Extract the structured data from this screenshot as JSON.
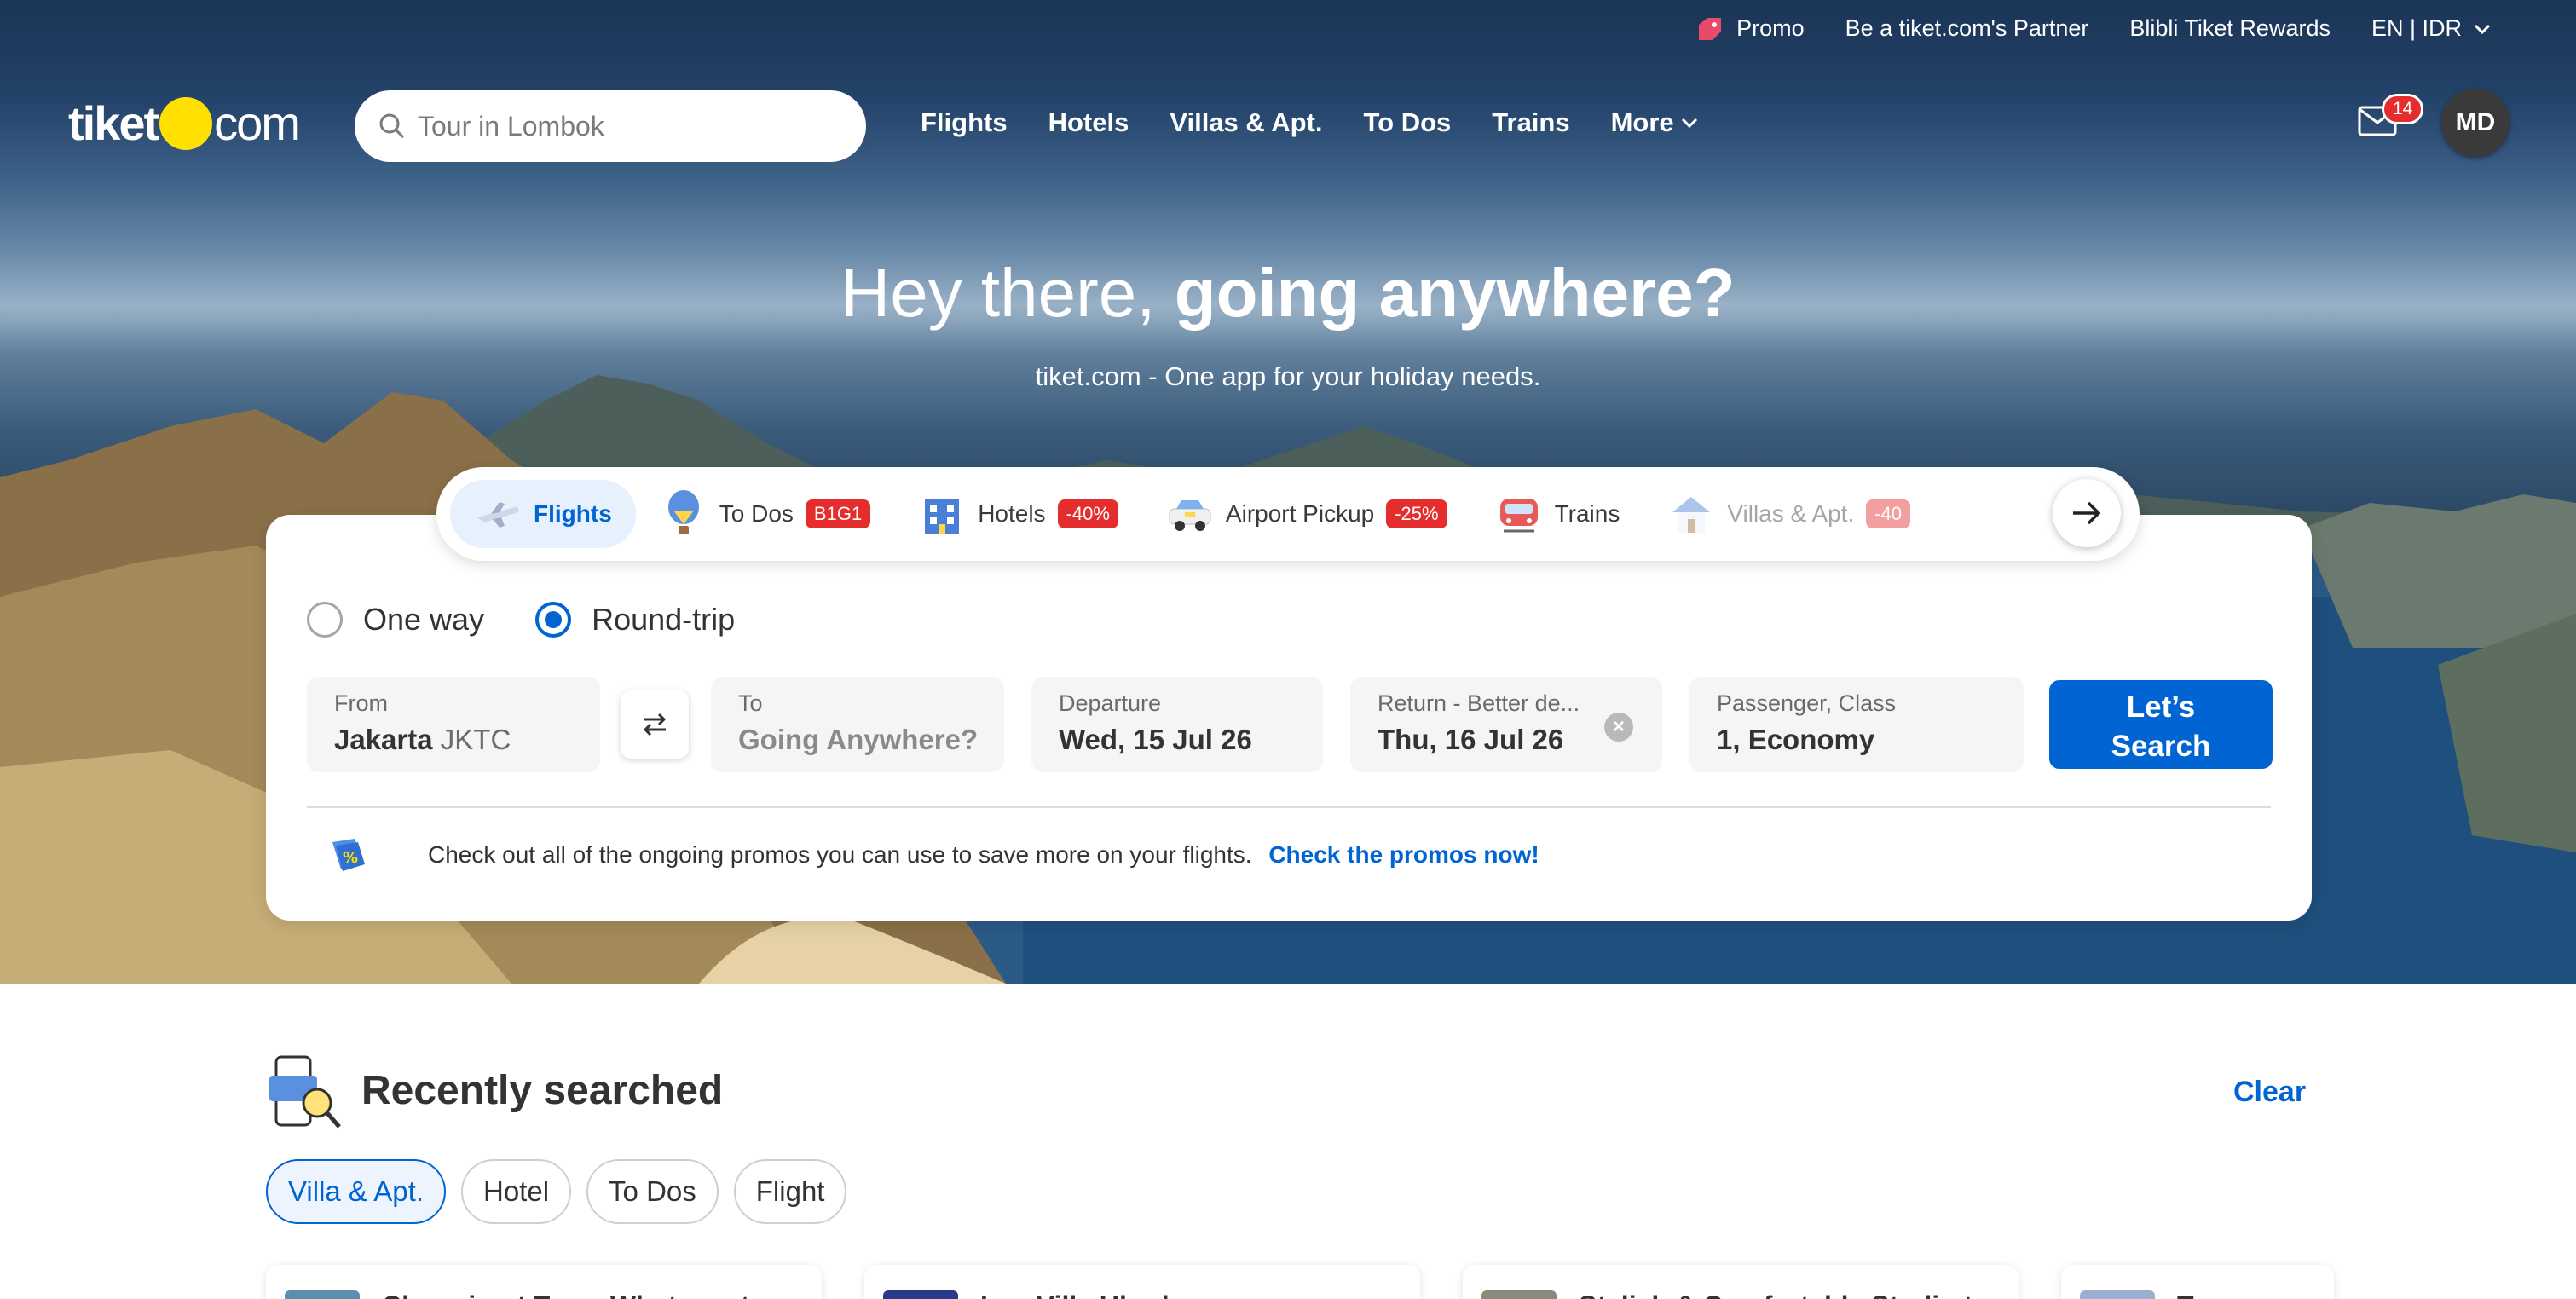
{
  "topbar": {
    "promo": "Promo",
    "partner": "Be a tiket.com's Partner",
    "rewards": "Blibli Tiket Rewards",
    "locale": "EN | IDR"
  },
  "logo": {
    "left": "tiket",
    "right": "com"
  },
  "search": {
    "placeholder": "Tour in Lombok"
  },
  "nav": {
    "items": [
      "Flights",
      "Hotels",
      "Villas & Apt.",
      "To Dos",
      "Trains"
    ],
    "more": "More"
  },
  "mail": {
    "badge": "14"
  },
  "user": {
    "initials": "MD"
  },
  "hero": {
    "headline_plain": "Hey there,",
    "headline_bold": "going anywhere?",
    "subtitle": "tiket.com - One app for your holiday needs."
  },
  "product_tabs": [
    {
      "label": "Flights",
      "badge": ""
    },
    {
      "label": "To Dos",
      "badge": "B1G1"
    },
    {
      "label": "Hotels",
      "badge": "-40%"
    },
    {
      "label": "Airport Pickup",
      "badge": "-25%"
    },
    {
      "label": "Trains",
      "badge": ""
    },
    {
      "label": "Villas & Apt.",
      "badge": "-40"
    }
  ],
  "trip_type": {
    "one_way": "One way",
    "round_trip": "Round-trip",
    "selected": "Round-trip"
  },
  "fields": {
    "from": {
      "label": "From",
      "city": "Jakarta",
      "code": "JKTC"
    },
    "to": {
      "label": "To",
      "placeholder": "Going Anywhere?"
    },
    "departure": {
      "label": "Departure",
      "value": "Wed, 15 Jul 26"
    },
    "return": {
      "label": "Return - Better de...",
      "value": "Thu, 16 Jul 26"
    },
    "passenger": {
      "label": "Passenger, Class",
      "value": "1, Economy"
    }
  },
  "search_button": {
    "line1": "Let’s",
    "line2": "Search"
  },
  "promo_bar": {
    "text": "Check out all of the ongoing promos you can use to save more on your flights.",
    "link": "Check the promos now!"
  },
  "recent": {
    "title": "Recently searched",
    "clear": "Clear",
    "chips": [
      "Villa & Apt.",
      "Hotel",
      "To Dos",
      "Flight"
    ],
    "active_chip": "Villa & Apt.",
    "cards": [
      "Charming t Town Whatever t",
      "Lux Villa Ubud",
      "Stylish & Comfortable Studio t",
      "Tr"
    ]
  },
  "colors": {
    "brand_blue": "#0064d2",
    "logo_yellow": "#ffe000",
    "badge_red": "#e52d2d"
  }
}
